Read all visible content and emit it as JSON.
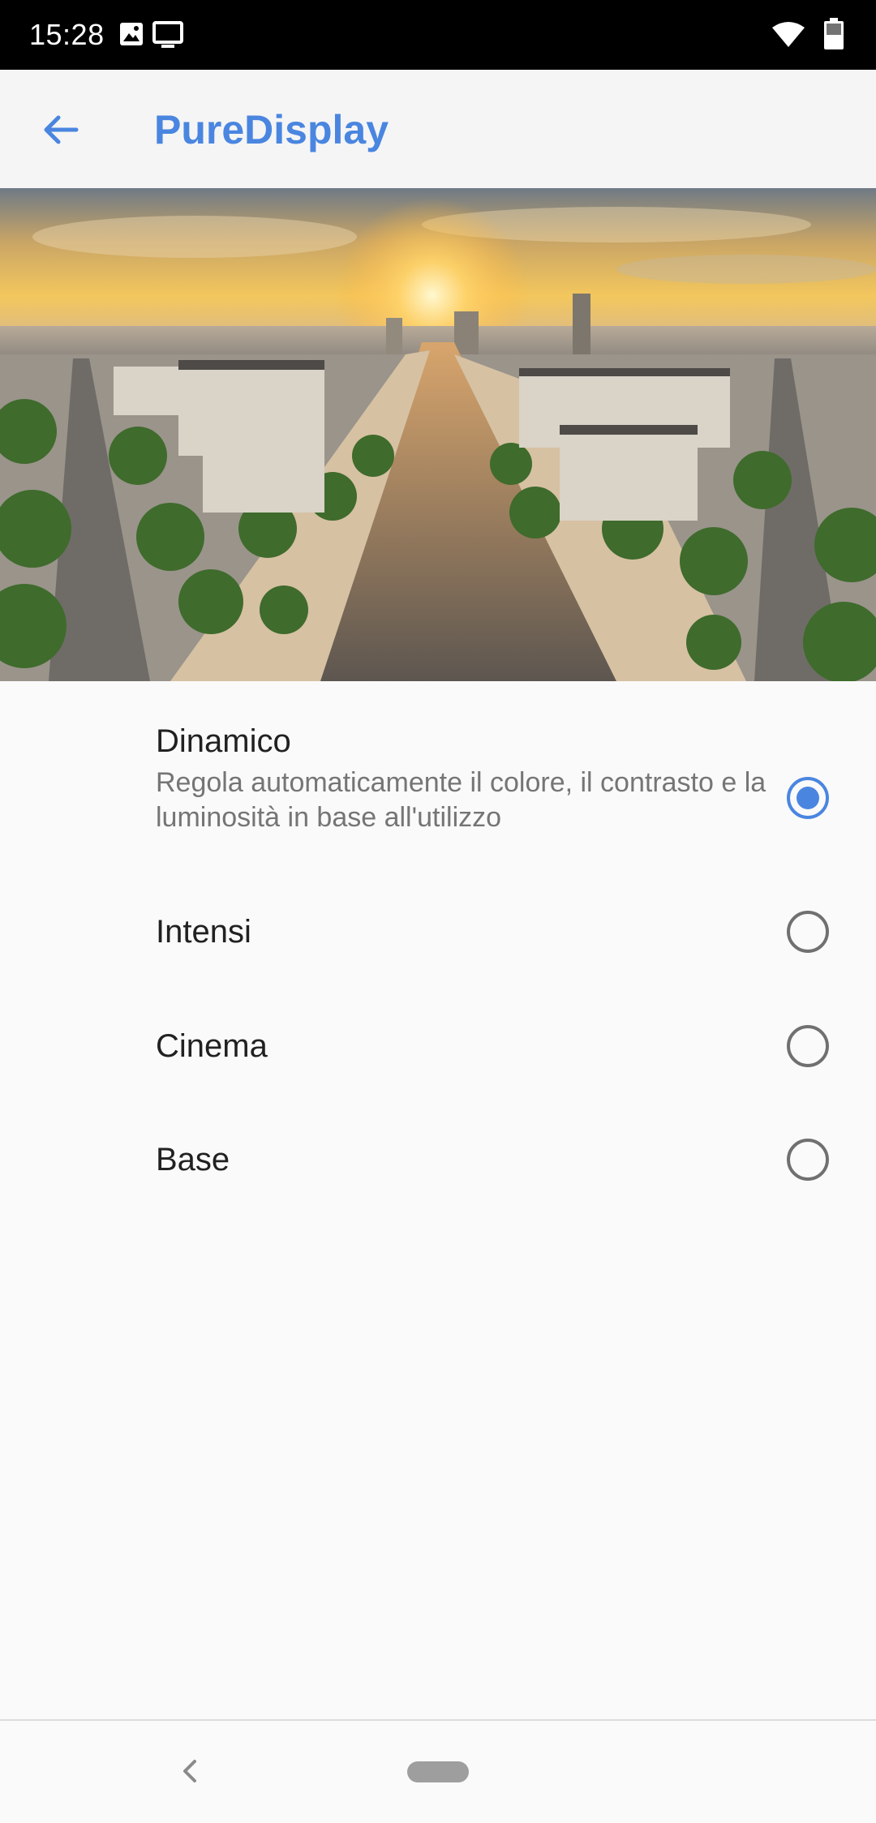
{
  "status_bar": {
    "time": "15:28",
    "left_icons": [
      "photo-notification-icon",
      "cast-screen-icon"
    ],
    "right_icons": [
      "wifi-icon",
      "battery-icon"
    ]
  },
  "app_bar": {
    "back_icon": "arrow-left-icon",
    "title": "PureDisplay"
  },
  "hero": {
    "image": "paris-avenue-sunset-photo"
  },
  "options": [
    {
      "title": "Dinamico",
      "summary": "Regola automaticamente il colore, il contrasto e la luminosità in base all'utilizzo",
      "checked": true
    },
    {
      "title": "Intensi",
      "summary": "",
      "checked": false
    },
    {
      "title": "Cinema",
      "summary": "",
      "checked": false
    },
    {
      "title": "Base",
      "summary": "",
      "checked": false
    }
  ],
  "nav_bar": {
    "back_icon": "chevron-left-icon",
    "home_icon": "home-pill-icon"
  },
  "colors": {
    "accent": "#4a86e0",
    "status_bar": "#000000",
    "background": "#fafafa",
    "radio_unchecked": "#707070"
  }
}
